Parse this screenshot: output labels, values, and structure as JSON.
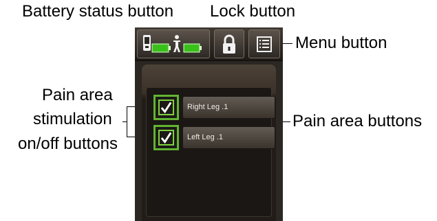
{
  "callouts": {
    "battery_status": "Battery status button",
    "lock": "Lock button",
    "menu": "Menu button",
    "stimulation_line1": "Pain area",
    "stimulation_line2": "stimulation",
    "stimulation_line3": "on/off buttons",
    "pain_area_buttons": "Pain area buttons"
  },
  "pain_areas": [
    {
      "label": "Right Leg .1",
      "stimulation_on": true
    },
    {
      "label": "Left Leg .1",
      "stimulation_on": true
    }
  ],
  "colors": {
    "battery_green": "#39c01b",
    "check_green": "#62b531",
    "device_dark": "#2b2722"
  },
  "icons": {
    "remote_battery": "remote-battery-icon",
    "implant_battery": "person-battery-icon",
    "lock": "lock-icon",
    "menu": "menu-list-icon",
    "check": "checkmark-icon"
  }
}
